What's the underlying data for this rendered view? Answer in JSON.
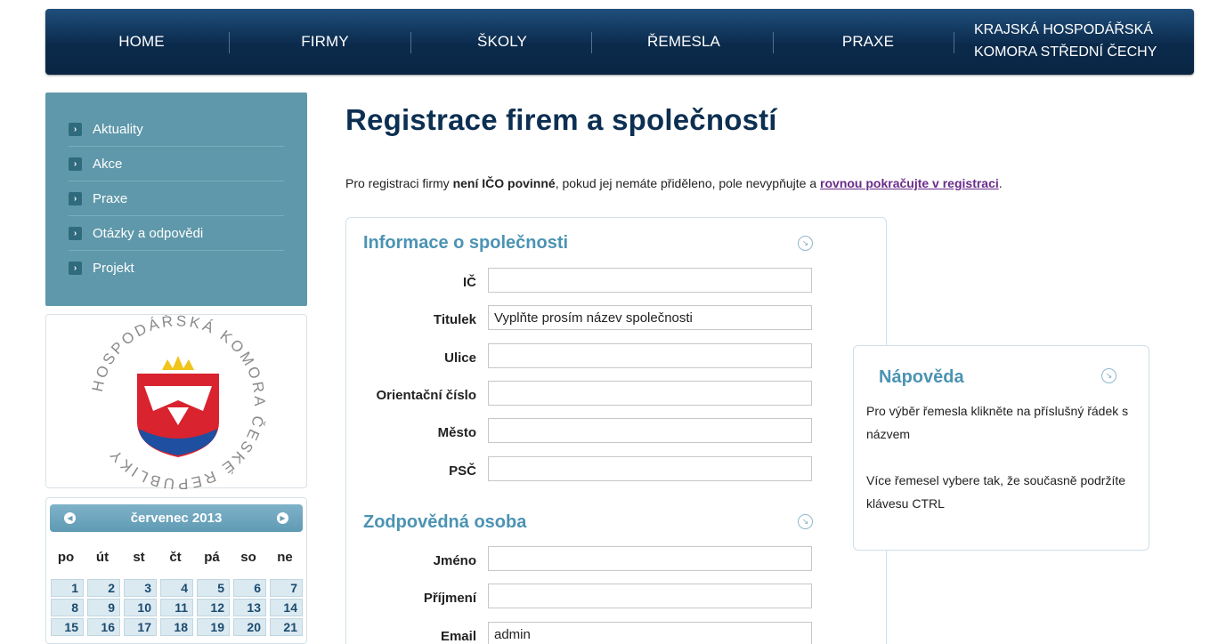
{
  "nav": {
    "items": [
      "HOME",
      "FIRMY",
      "ŠKOLY",
      "ŘEMESLA",
      "PRAXE"
    ],
    "org_line1": "KRAJSKÁ HOSPODÁŘSKÁ",
    "org_line2": "KOMORA STŘEDNÍ ČECHY"
  },
  "sidebar": {
    "items": [
      {
        "label": "Aktuality"
      },
      {
        "label": "Akce"
      },
      {
        "label": "Praxe"
      },
      {
        "label": "Otázky a odpovědi"
      },
      {
        "label": "Projekt"
      }
    ]
  },
  "logo": {
    "text": "HOSPODÁŘSKÁ KOMORA ČESKÉ REPUBLIKY",
    "colors": {
      "red": "#d9232e",
      "blue": "#1f4fa0",
      "gold": "#f0c419",
      "gray": "#8a8a8a"
    }
  },
  "calendar": {
    "title": "červenec 2013",
    "weekdays": [
      "po",
      "út",
      "st",
      "čt",
      "pá",
      "so",
      "ne"
    ],
    "weeks": [
      [
        "1",
        "2",
        "3",
        "4",
        "5",
        "6",
        "7"
      ],
      [
        "8",
        "9",
        "10",
        "11",
        "12",
        "13",
        "14"
      ],
      [
        "15",
        "16",
        "17",
        "18",
        "19",
        "20",
        "21"
      ]
    ]
  },
  "page": {
    "title": "Registrace firem a společností",
    "intro_before": "Pro registraci firmy ",
    "intro_bold": "není IČO povinné",
    "intro_middle": ", pokud jej nemáte přiděleno, pole nevypňujte a ",
    "intro_link": "rovnou pokračujte v registraci",
    "intro_after": "."
  },
  "form": {
    "company_section": "Informace o společnosti",
    "company_fields": [
      {
        "label": "IČ",
        "value": "",
        "placeholder": ""
      },
      {
        "label": "Titulek",
        "value": "Vyplňte prosím název společnosti",
        "placeholder": ""
      },
      {
        "label": "Ulice",
        "value": "",
        "placeholder": ""
      },
      {
        "label": "Orientační číslo",
        "value": "",
        "placeholder": ""
      },
      {
        "label": "Město",
        "value": "",
        "placeholder": ""
      },
      {
        "label": "PSČ",
        "value": "",
        "placeholder": ""
      }
    ],
    "person_section": "Zodpovědná osoba",
    "person_fields": [
      {
        "label": "Jméno",
        "value": "",
        "placeholder": ""
      },
      {
        "label": "Příjmení",
        "value": "",
        "placeholder": ""
      },
      {
        "label": "Email",
        "value": "admin",
        "placeholder": ""
      }
    ]
  },
  "help": {
    "title": "Nápověda",
    "paragraph1": "Pro výběr řemesla klikněte na příslušný řádek s názvem",
    "paragraph2": "Více řemesel vybere tak, že současně podržíte klávesu CTRL"
  },
  "colors": {
    "nav_bg": "#0b2a4b",
    "sidebar_bg": "#5f98aa",
    "heading": "#0c2f52",
    "section_heading": "#4b93b3",
    "link": "#6a2b8a"
  }
}
